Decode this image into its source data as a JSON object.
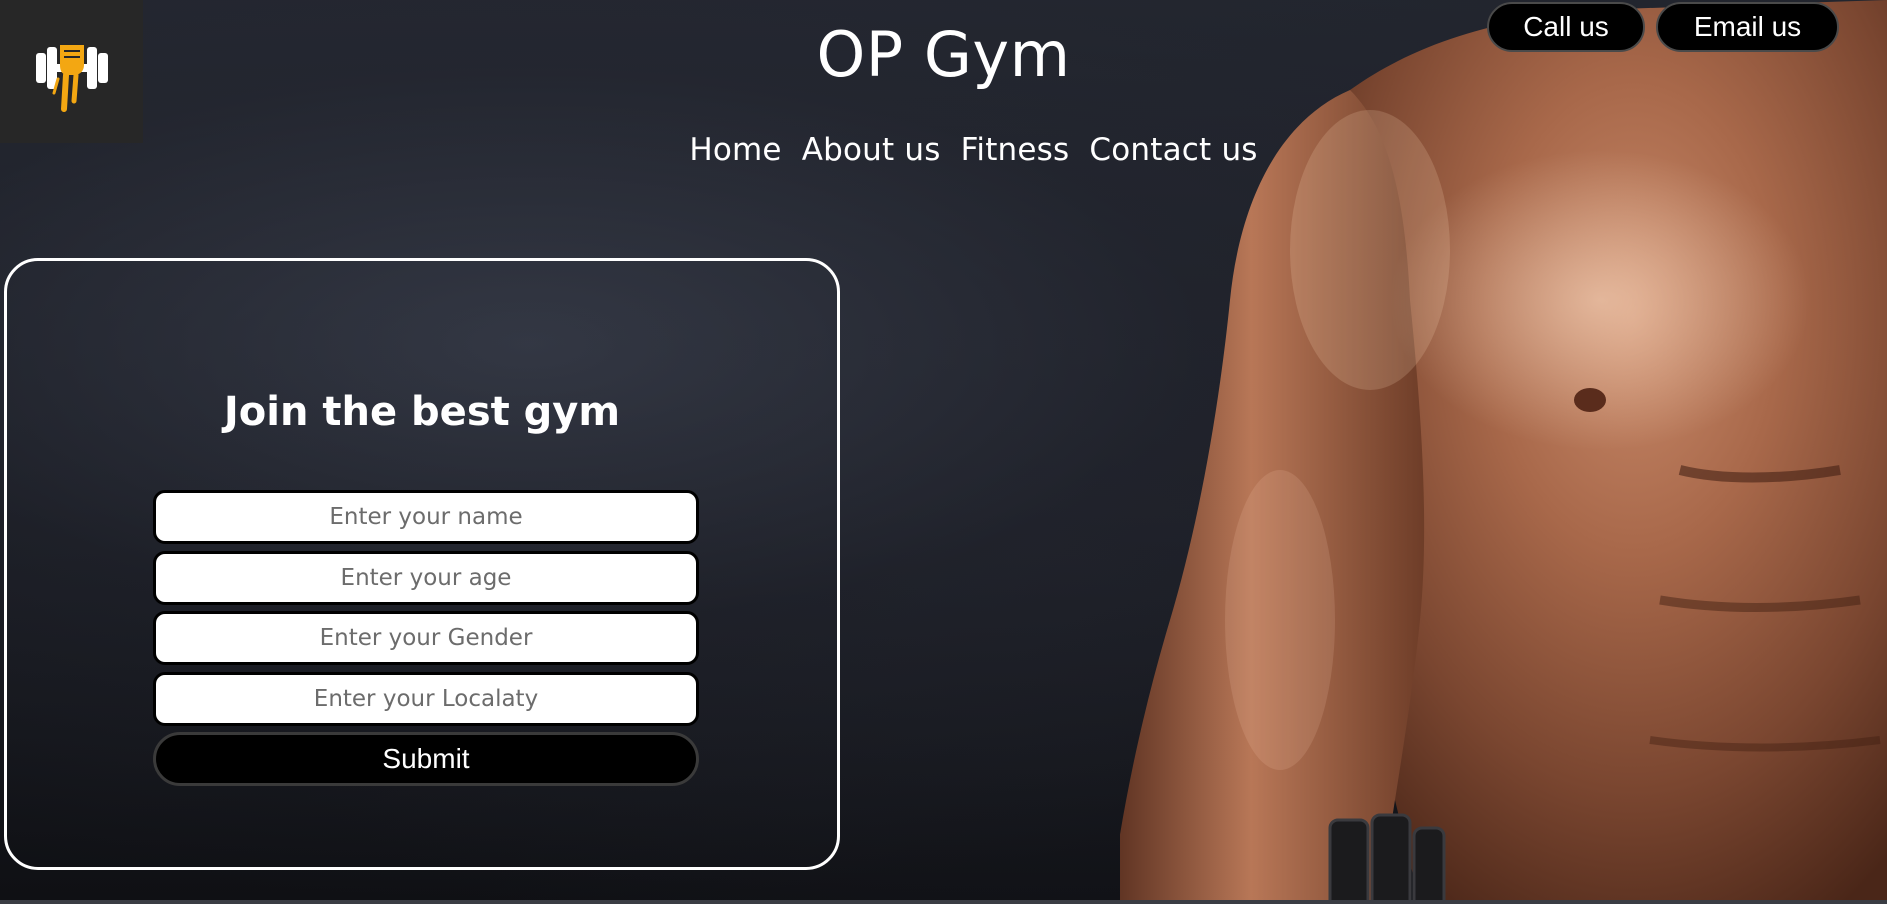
{
  "header": {
    "title": "OP Gym",
    "logo_icon": "dumbbell-fist-icon",
    "accent_color": "#f3a712"
  },
  "nav": {
    "items": [
      {
        "label": "Home"
      },
      {
        "label": "About us"
      },
      {
        "label": "Fitness"
      },
      {
        "label": "Contact us"
      }
    ]
  },
  "contact_buttons": {
    "call_label": "Call us",
    "email_label": "Email us"
  },
  "form": {
    "heading": "Join the best gym",
    "name_placeholder": "Enter your name",
    "age_placeholder": "Enter your age",
    "gender_placeholder": "Enter your Gender",
    "locality_placeholder": "Enter your Localaty",
    "submit_label": "Submit"
  }
}
